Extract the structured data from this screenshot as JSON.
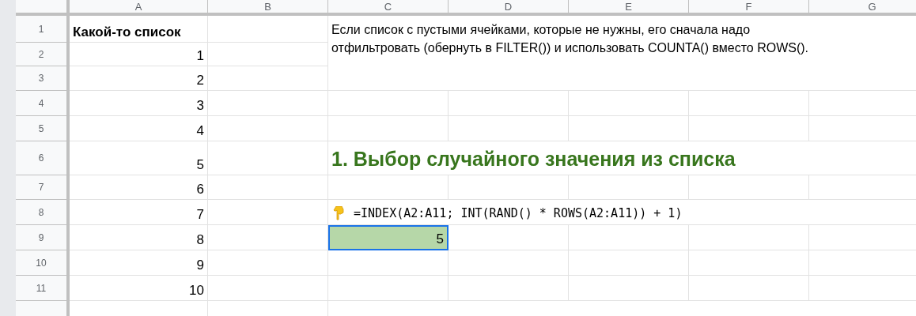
{
  "column_headers": [
    "A",
    "B",
    "C",
    "D",
    "E",
    "F",
    "G"
  ],
  "rows": [
    {
      "number": "1",
      "value": "Какой-то список",
      "kind": "title"
    },
    {
      "number": "2",
      "value": "1",
      "kind": "number"
    },
    {
      "number": "3",
      "value": "2",
      "kind": "number"
    },
    {
      "number": "4",
      "value": "3",
      "kind": "number"
    },
    {
      "number": "5",
      "value": "4",
      "kind": "number"
    },
    {
      "number": "6",
      "value": "5",
      "kind": "number"
    },
    {
      "number": "7",
      "value": "6",
      "kind": "number"
    },
    {
      "number": "8",
      "value": "7",
      "kind": "number"
    },
    {
      "number": "9",
      "value": "8",
      "kind": "number"
    },
    {
      "number": "10",
      "value": "9",
      "kind": "number"
    },
    {
      "number": "11",
      "value": "10",
      "kind": "number"
    }
  ],
  "note": "Если список с пустыми ячейками, которые не нужны, его сначала надо отфильтровать (обернуть в FILTER()) и использовать COUNTA() вместо ROWS().",
  "heading": "1. Выбор случайного значения из списка",
  "formula": "=INDEX(A2:A11; INT(RAND() * ROWS(A2:A11)) + 1)",
  "result": {
    "value": "5",
    "selected": true
  }
}
